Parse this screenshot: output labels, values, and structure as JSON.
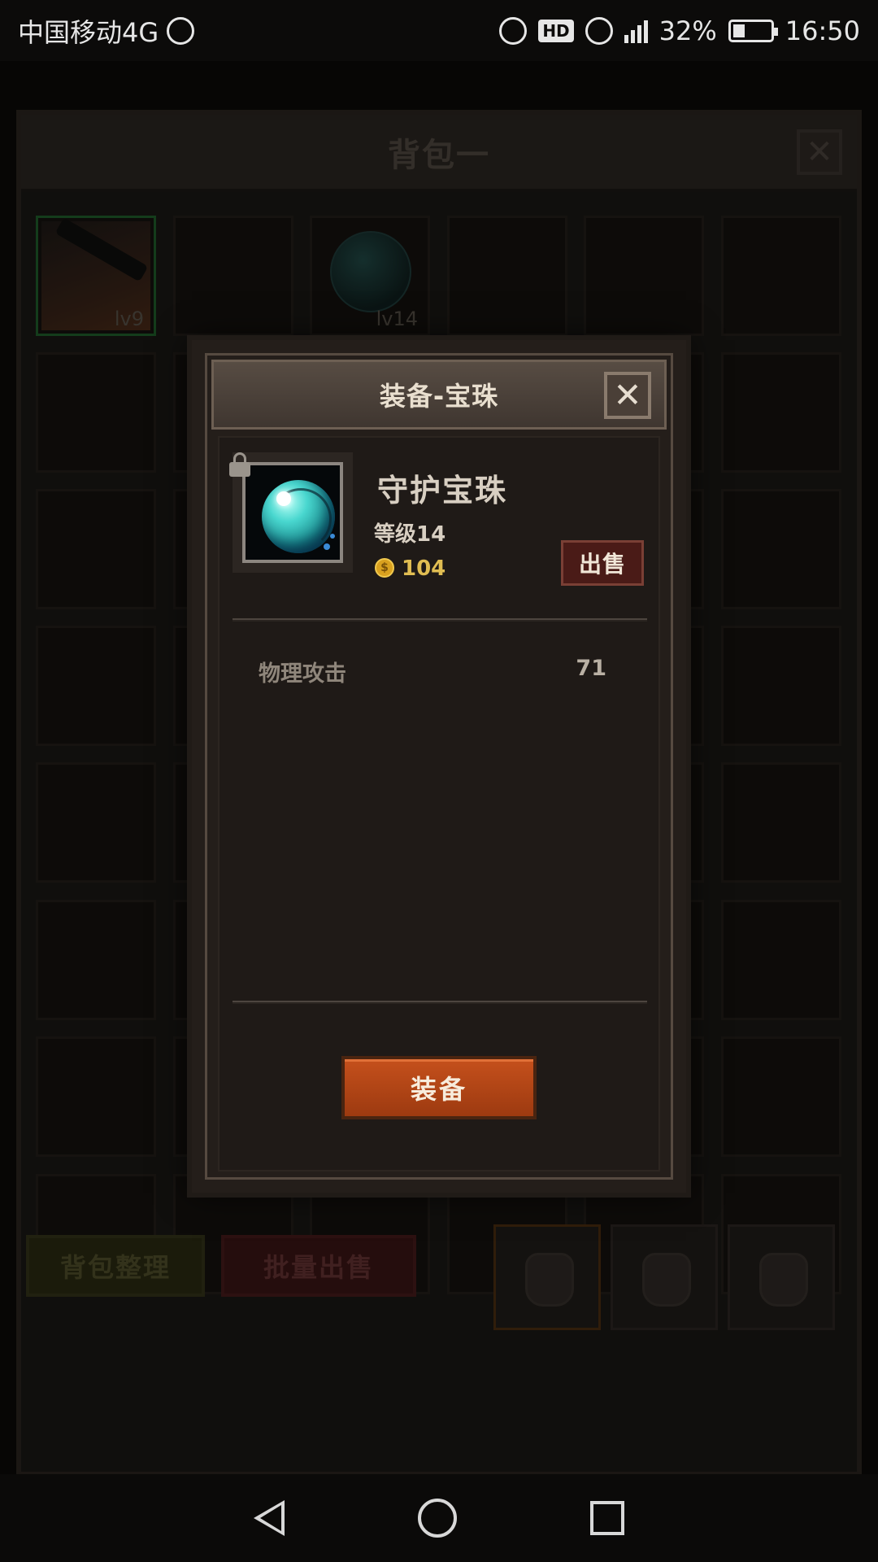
{
  "status_bar": {
    "carrier": "中国移动4G",
    "hd_badge": "HD",
    "battery": "32%",
    "battery_level": 0.32,
    "time": "16:50"
  },
  "bag": {
    "title": "背包一",
    "slots": [
      {
        "level": "lv9",
        "equipped": true
      },
      {
        "level": ""
      },
      {
        "level": "lv14"
      }
    ],
    "buttons": {
      "sort": "背包整理",
      "bulk_sell": "批量出售"
    }
  },
  "dialog": {
    "title": "装备-宝珠",
    "item": {
      "name": "守护宝珠",
      "level": "等级14",
      "price": "104",
      "coin_symbol": "$",
      "icon": "teal-orb-icon"
    },
    "sell_label": "出售",
    "stats": [
      {
        "label": "物理攻击",
        "value": "71"
      }
    ],
    "equip_label": "装备"
  },
  "colors": {
    "equip_button": "#b8481a",
    "sell_button": "#4a1b17",
    "price_gold": "#e0bd52"
  }
}
